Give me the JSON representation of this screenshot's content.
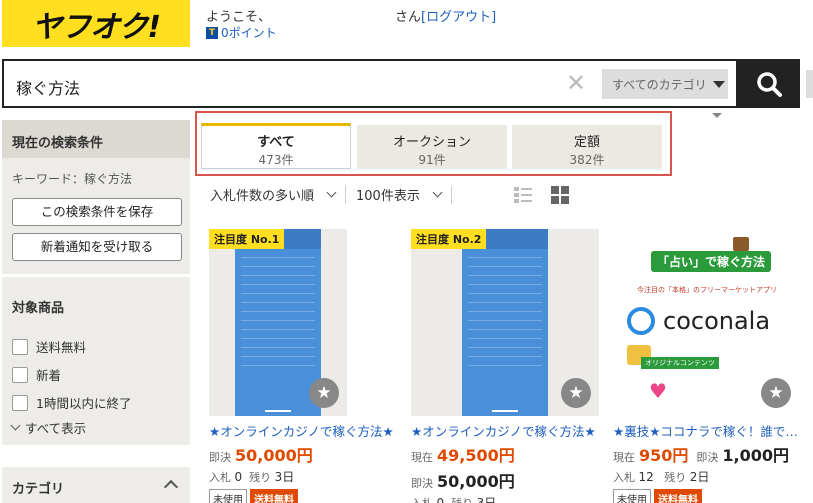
{
  "header": {
    "logo": "ヤフオク!",
    "welcome_prefix": "ようこそ、",
    "user_suffix": "さん",
    "logout": "[ログアウト]",
    "points": "0ポイント"
  },
  "search": {
    "query": "稼ぐ方法",
    "category": "すべてのカテゴリ"
  },
  "sidebar": {
    "current_conditions": "現在の検索条件",
    "keyword_line": "キーワード：稼ぐ方法",
    "save_button": "この検索条件を保存",
    "notify_button": "新着通知を受け取る",
    "target_heading": "対象商品",
    "filters": [
      "送料無料",
      "新着",
      "1時間以内に終了"
    ],
    "show_all": "すべて表示",
    "category_heading": "カテゴリ"
  },
  "tabs": [
    {
      "label": "すべて",
      "count": "473件"
    },
    {
      "label": "オークション",
      "count": "91件"
    },
    {
      "label": "定額",
      "count": "382件"
    }
  ],
  "sortbar": {
    "sort": "入札件数の多い順",
    "per_page": "100件表示"
  },
  "products": [
    {
      "badge": "注目度 No.1",
      "title": "★オンラインカジノで稼ぐ方法★",
      "price_label": "即決",
      "price": "50,000円",
      "bids_label": "入札",
      "bids": "0",
      "remain_label": "残り",
      "remain": "3日",
      "tag_used": "未使用",
      "tag_ship": "送料無料"
    },
    {
      "badge": "注目度 No.2",
      "title": "★オンラインカジノで稼ぐ方法★",
      "price_label": "現在",
      "price": "49,500円",
      "buyout_label": "即決",
      "buyout": "50,000円",
      "bids_label": "入札",
      "bids": "0",
      "remain_label": "残り",
      "remain": "3日"
    },
    {
      "title": "★裏技★ココナラで稼ぐ！誰で…",
      "price_label": "現在",
      "price": "950円",
      "buyout_label": "即決",
      "buyout": "1,000円",
      "bids_label": "入札",
      "bids": "12",
      "remain_label": "残り",
      "remain": "2日",
      "tag_used": "未使用",
      "tag_ship": "送料無料",
      "image_text": {
        "headline": "「占い」で稼ぐ方法",
        "sub": "今注目の「本格」のフリーマーケットアプリ",
        "brand": "coconala",
        "original": "オリジナルコンテンツ"
      }
    }
  ],
  "colors": {
    "brand_yellow": "#ffdf1f",
    "link_blue": "#1d5fbf",
    "price_red": "#e04a00",
    "highlight_border": "#d9534f"
  }
}
